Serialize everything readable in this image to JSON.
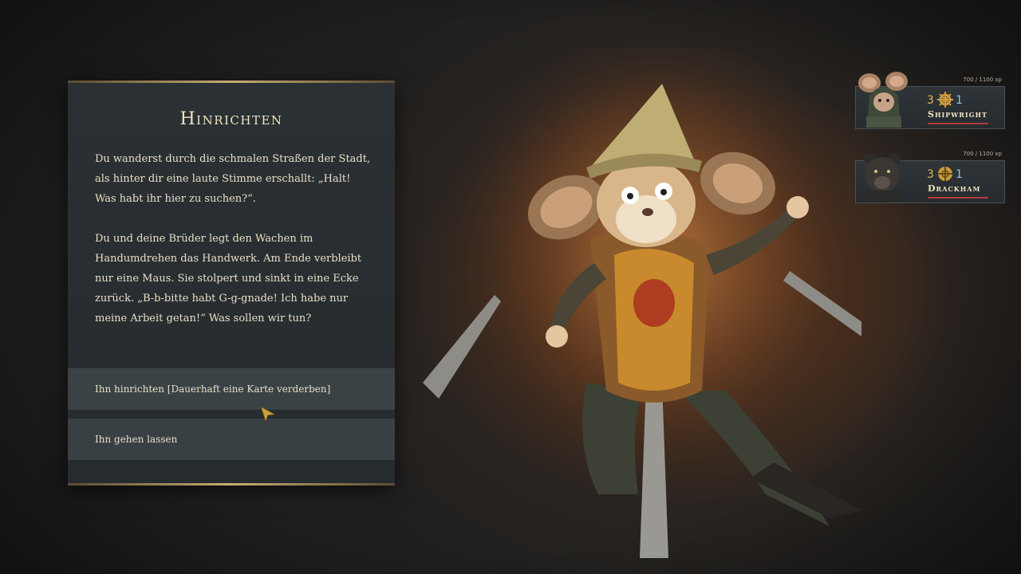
{
  "event": {
    "title": "Hinrichten",
    "paragraphs": [
      "Du wanderst durch die schmalen Straßen der Stadt, als hinter dir eine laute Stimme erschallt: „Halt! Was habt ihr hier zu suchen?“.",
      "Du und deine Brüder legt den Wachen im Handumdrehen das Handwerk. Am Ende verbleibt nur eine Maus. Sie stolpert und sinkt in eine Ecke zurück. „B-b-bitte habt G-g-gnade! Ich habe nur meine Arbeit getan!“ Was sollen wir tun?"
    ],
    "choices": [
      {
        "label": "Ihn hinrichten [Dauerhaft eine Karte verderben]"
      },
      {
        "label": "Ihn gehen lassen"
      }
    ]
  },
  "party": [
    {
      "name": "Shipwright",
      "xp": "700 / 1100 xp",
      "stat_a": "3",
      "stat_b": "1",
      "icon": "gear-cross-icon",
      "portrait": "mouse-hooded-portrait"
    },
    {
      "name": "Drackham",
      "xp": "700 / 1100 xp",
      "stat_a": "3",
      "stat_b": "1",
      "icon": "shield-wheel-icon",
      "portrait": "bear-portrait"
    }
  ],
  "colors": {
    "accent_gold": "#c9ad74",
    "stat_gold": "#e4b84a",
    "stat_blue": "#8ec6e6",
    "health_red": "#b83a36"
  }
}
